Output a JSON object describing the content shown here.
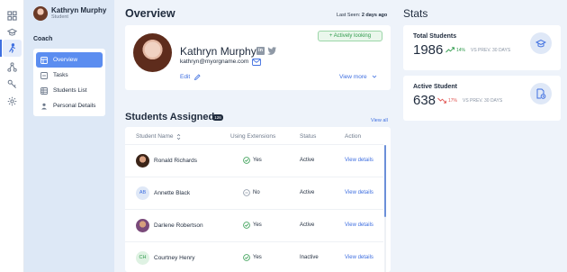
{
  "user": {
    "name": "Kathryn Murphy",
    "role": "Student"
  },
  "sidebar": {
    "section": "Coach",
    "items": [
      {
        "label": "Overview",
        "icon": "overview-icon",
        "active": true
      },
      {
        "label": "Tasks",
        "icon": "tasks-icon",
        "active": false
      },
      {
        "label": "Students List",
        "icon": "students-list-icon",
        "active": false
      },
      {
        "label": "Personal Details",
        "icon": "person-icon",
        "active": false
      }
    ]
  },
  "rail": {
    "icons": [
      "dashboard-icon",
      "graduation-cap-icon",
      "person-running-icon",
      "network-icon",
      "keys-icon",
      "settings-icon"
    ]
  },
  "overview": {
    "title": "Overview",
    "last_seen_label": "Last Seen:",
    "last_seen_value": "2 days ago",
    "name": "Kathryn Murphy",
    "email": "kathryn@myorgname.com",
    "badge": "+ Actively looking",
    "edit": "Edit",
    "view_more": "View more"
  },
  "students": {
    "title": "Students Assigned",
    "count": "126",
    "view_all": "View all",
    "columns": [
      "Student Name",
      "Using Extensions",
      "Status",
      "Action"
    ],
    "rows": [
      {
        "name": "Ronald Richards",
        "initials": "",
        "extensions": "Yes",
        "status": "Active",
        "action": "View details"
      },
      {
        "name": "Annette Black",
        "initials": "AB",
        "extensions": "No",
        "status": "Active",
        "action": "View details"
      },
      {
        "name": "Darlene Robertson",
        "initials": "",
        "extensions": "Yes",
        "status": "Active",
        "action": "View details"
      },
      {
        "name": "Courtney Henry",
        "initials": "CH",
        "extensions": "Yes",
        "status": "Inactive",
        "action": "View details"
      }
    ]
  },
  "stats": {
    "title": "Stats",
    "cards": [
      {
        "title": "Total Students",
        "value": "1986",
        "pct": "14%",
        "vs": "VS PREV. 30 DAYS",
        "trend": "up",
        "color": "#2f9a4c"
      },
      {
        "title": "Active Student",
        "value": "638",
        "pct": "17%",
        "vs": "VS PREV. 30 DAYS",
        "trend": "down",
        "color": "#e0524f"
      }
    ]
  },
  "colors": {
    "accent": "#3f6fe0",
    "menu_active": "#5b8df0",
    "panel": "#dde8f6",
    "success": "#2f9a4c",
    "danger": "#e0524f"
  }
}
